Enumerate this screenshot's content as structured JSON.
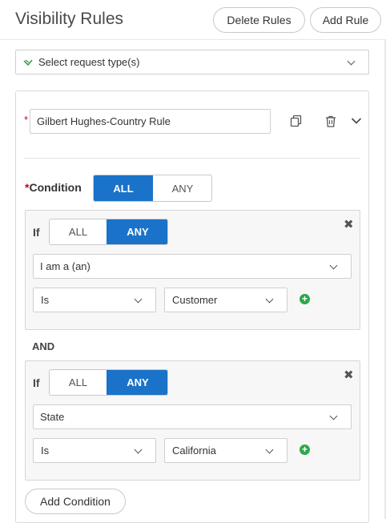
{
  "header": {
    "title": "Visibility Rules",
    "delete_rules": "Delete Rules",
    "add_rule": "Add Rule"
  },
  "request_type": {
    "placeholder": "Select request type(s)"
  },
  "rule": {
    "name": "Gilbert Hughes-Country Rule",
    "required_marker": "*",
    "condition_label": "Condition",
    "condition_options": [
      "ALL",
      "ANY"
    ],
    "condition_selected": "ALL"
  },
  "conditions": [
    {
      "if_label": "If",
      "options": [
        "ALL",
        "ANY"
      ],
      "selected": "ANY",
      "attribute": "I am a (an)",
      "operator": "Is",
      "value": "Customer"
    },
    {
      "if_label": "If",
      "options": [
        "ALL",
        "ANY"
      ],
      "selected": "ANY",
      "attribute": "State",
      "operator": "Is",
      "value": "California"
    }
  ],
  "joiner": "AND",
  "add_condition": "Add Condition",
  "icons": {
    "close": "✖",
    "add": "+"
  },
  "colors": {
    "accent": "#1a73c9",
    "add_green": "#2ea84a",
    "required_red": "#d0021b"
  }
}
